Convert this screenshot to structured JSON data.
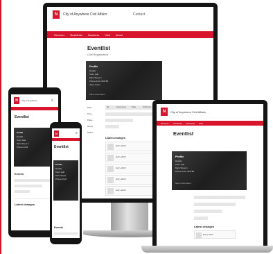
{
  "devices": {
    "monitor": {
      "site_title": "City of Anywhere Civil Affairs",
      "header_action": "Contact",
      "nav": [
        "Services",
        "Residents",
        "Business",
        "Visit",
        "About"
      ],
      "page_heading": "Eventlist",
      "page_subtitle": "Civil Registration",
      "card_title": "Profile",
      "card_lines": [
        "Details",
        "Town Hall",
        "Main Street 1",
        "Phone 0123 456789",
        "Open hours"
      ],
      "card_footer": "More information",
      "filter_labels": [
        "Date",
        "Type",
        "Place",
        "Group",
        "Status"
      ],
      "tabs": [
        "All",
        "Upcoming",
        "Past",
        "Archived"
      ],
      "list_heading": "Latest changes",
      "list_items": [
        "Entry 2023",
        "Entry 2023",
        "Entry 2023",
        "Entry 2023",
        "Entry 2023"
      ]
    },
    "laptop": {
      "site_title": "City of Anywhere Civil Affairs",
      "nav": [
        "Services",
        "Residents",
        "Business",
        "Visit"
      ],
      "page_heading": "Eventlist",
      "card_title": "Profile",
      "card_lines": [
        "Details",
        "Town Hall",
        "Main Street 1",
        "Phone 0123 456789"
      ],
      "card_footer": "More information",
      "list_heading": "Latest changes",
      "list_items": [
        "Entry 2023"
      ]
    },
    "tablet": {
      "site_title": "City of Anywhere",
      "page_heading": "Eventlist",
      "card_title": "Profile",
      "card_lines": [
        "Details",
        "Town Hall",
        "Main Street 1",
        "Phone 0123"
      ],
      "section_heading": "Events",
      "footer_heading": "Latest changes"
    },
    "phone": {
      "page_heading": "Eventlist",
      "card_title": "Profile",
      "card_lines": [
        "Details",
        "Town Hall",
        "Main Street",
        "Phone 0123"
      ],
      "section_heading": "Events"
    }
  },
  "colors": {
    "brand": "#d8152d",
    "card": "#2a2a2a",
    "bezel": "#151515"
  }
}
